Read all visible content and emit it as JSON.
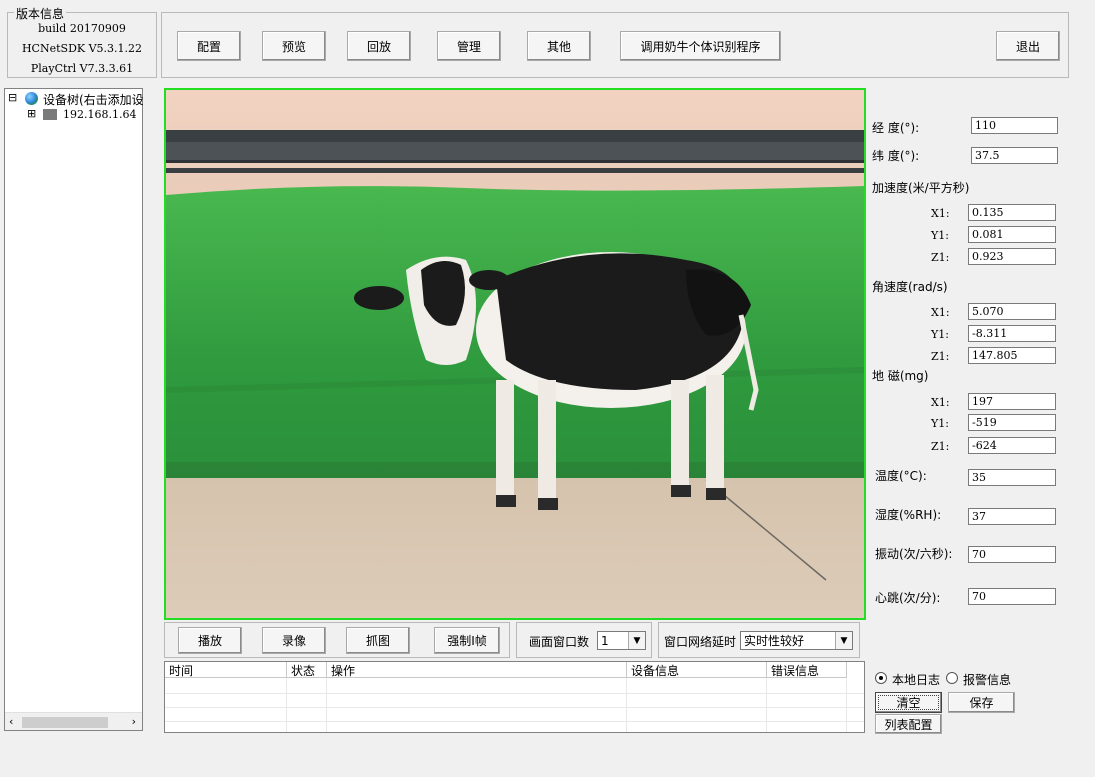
{
  "version_group": {
    "title": "版本信息",
    "lines": [
      "build 20170909",
      "HCNetSDK V5.3.1.22",
      "PlayCtrl V7.3.3.61"
    ]
  },
  "toolbar": {
    "config": "配置",
    "preview": "预览",
    "playback": "回放",
    "manage": "管理",
    "other": "其他",
    "cow_id": "调用奶牛个体识别程序",
    "exit": "退出"
  },
  "tree": {
    "root_label": "设备树(右击添加设",
    "device_ip": "192.168.1.64",
    "root_toggle": "⊟",
    "child_toggle": "⊞"
  },
  "sensors": {
    "longitude_label": "经  度(°):",
    "longitude": "110",
    "latitude_label": "纬  度(°):",
    "latitude": "37.5",
    "accel_title": "加速度(米/平方秒)",
    "accel": {
      "x_label": "X1:",
      "x": "0.135",
      "y_label": "Y1:",
      "y": "0.081",
      "z_label": "Z1:",
      "z": "0.923"
    },
    "gyro_title": "角速度(rad/s)",
    "gyro": {
      "x_label": "X1:",
      "x": "5.070",
      "y_label": "Y1:",
      "y": "-8.311",
      "z_label": "Z1:",
      "z": "147.805"
    },
    "mag_title": "地  磁(mg)",
    "mag": {
      "x_label": "X1:",
      "x": "197",
      "y_label": "Y1:",
      "y": "-519",
      "z_label": "Z1:",
      "z": "-624"
    },
    "temp_label": "温度(°C):",
    "temp": "35",
    "humidity_label": "湿度(%RH):",
    "humidity": "37",
    "vibration_label": "振动(次/六秒):",
    "vibration": "70",
    "heartbeat_label": "心跳(次/分):",
    "heartbeat": "70"
  },
  "controls": {
    "play": "播放",
    "record": "录像",
    "capture": "抓图",
    "force_iframe": "强制I帧",
    "window_count_label": "画面窗口数",
    "window_count": "1",
    "delay_label": "窗口网络延时",
    "delay_value": "实时性较好"
  },
  "log_table": {
    "columns": [
      "时间",
      "状态",
      "操作",
      "设备信息",
      "错误信息"
    ]
  },
  "log_options": {
    "local_log": "本地日志",
    "alarm_info": "报警信息",
    "selected": "local_log",
    "clear": "清空",
    "save": "保存",
    "list_config": "列表配置"
  },
  "colors": {
    "video_border": "#22dd22",
    "window_bg": "#f0f0f0"
  }
}
